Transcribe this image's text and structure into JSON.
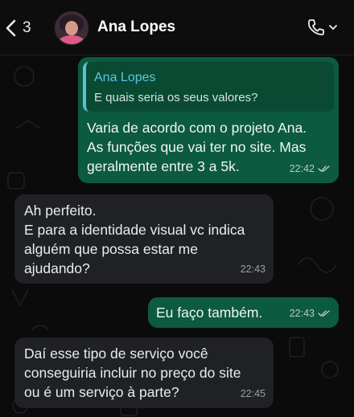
{
  "header": {
    "unread_count": "3",
    "contact_name": "Ana Lopes"
  },
  "messages": [
    {
      "direction": "outgoing",
      "quote": {
        "author": "Ana Lopes",
        "text": "E quais seria os seus valores?"
      },
      "text": "Varia de acordo com o projeto Ana.\nAs funções que vai ter no site. Mas\ngeralmente entre 3 a 5k.",
      "time": "22:42",
      "status": "read"
    },
    {
      "direction": "incoming",
      "text": "Ah perfeito.\nE para a identidade visual vc indica\nalguém que possa estar me\najudando?",
      "time": "22:43"
    },
    {
      "direction": "outgoing",
      "text": "Eu faço também.",
      "time": "22:43",
      "status": "read"
    },
    {
      "direction": "incoming",
      "text": "Daí esse tipo de serviço você\nconseguiria incluir no preço do site\nou é um serviço à parte?",
      "time": "22:45"
    }
  ],
  "colors": {
    "outgoing_bubble": "#0c5a3f",
    "incoming_bubble": "#1f2124",
    "quote_accent": "#5bc0de",
    "background": "#0b0b0b"
  }
}
